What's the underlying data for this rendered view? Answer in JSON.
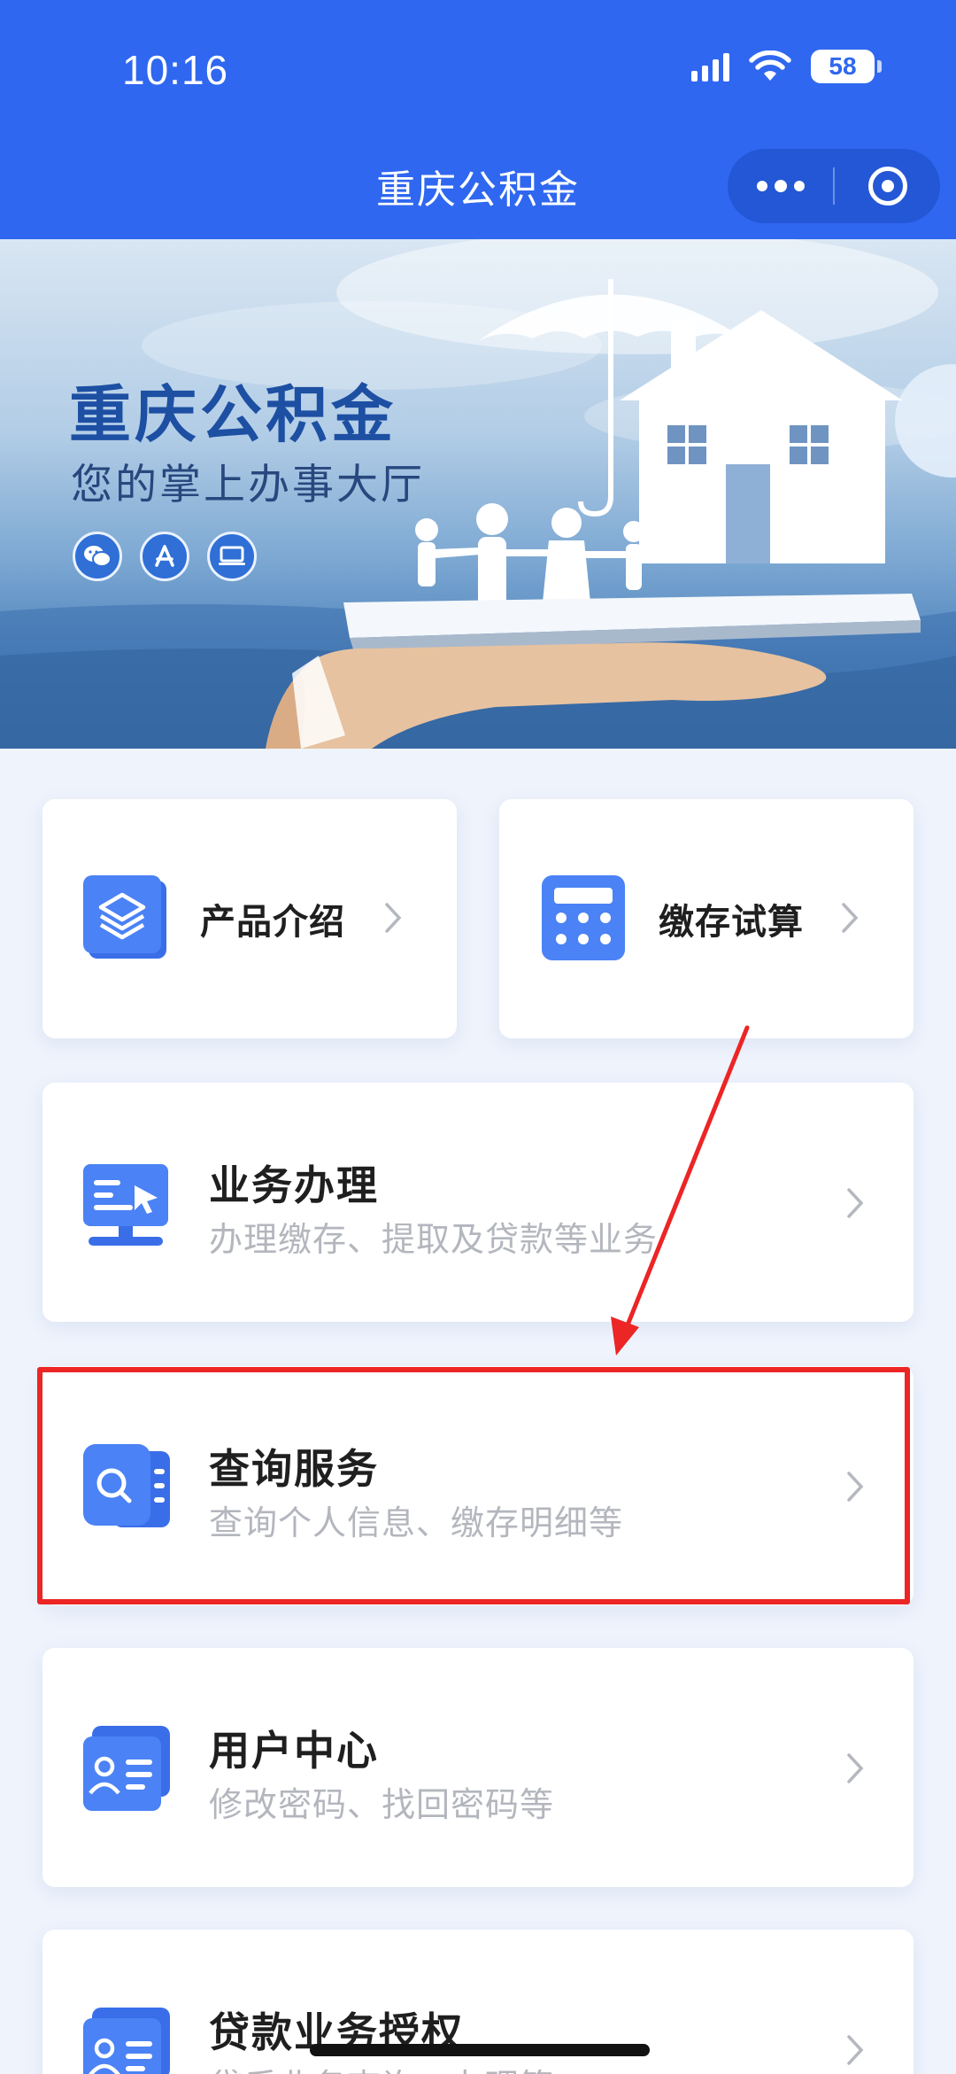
{
  "status_bar": {
    "time": "10:16",
    "battery": "58",
    "icons": [
      "signal-icon",
      "wifi-icon",
      "battery-icon"
    ]
  },
  "nav": {
    "title": "重庆公积金",
    "more_icon": "more-dots-icon",
    "close_icon": "miniprogram-close-icon"
  },
  "banner": {
    "title": "重庆公积金",
    "subtitle": "您的掌上办事大厅",
    "platform_icons": [
      "wechat-icon",
      "app-store-icon",
      "computer-icon"
    ]
  },
  "quick_cards": [
    {
      "label": "产品介绍",
      "icon": "layers-icon"
    },
    {
      "label": "缴存试算",
      "icon": "calculator-icon"
    }
  ],
  "service_cards": [
    {
      "title": "业务办理",
      "desc": "办理缴存、提取及贷款等业务",
      "icon": "monitor-icon"
    },
    {
      "title": "查询服务",
      "desc": "查询个人信息、缴存明细等",
      "icon": "search-doc-icon",
      "highlighted": true
    },
    {
      "title": "用户中心",
      "desc": "修改密码、找回密码等",
      "icon": "user-card-icon"
    },
    {
      "title": "贷款业务授权",
      "desc": "贷后业务查询、办理等",
      "icon": "user-card-icon"
    }
  ],
  "colors": {
    "nav_bg": "#2f67f0",
    "accent_blue": "#3f74ea",
    "page_bg": "#eef3fc",
    "desc_gray": "#b3b6bd",
    "highlight_red": "#ec2525",
    "annotation_arrow": "#ec2525"
  }
}
